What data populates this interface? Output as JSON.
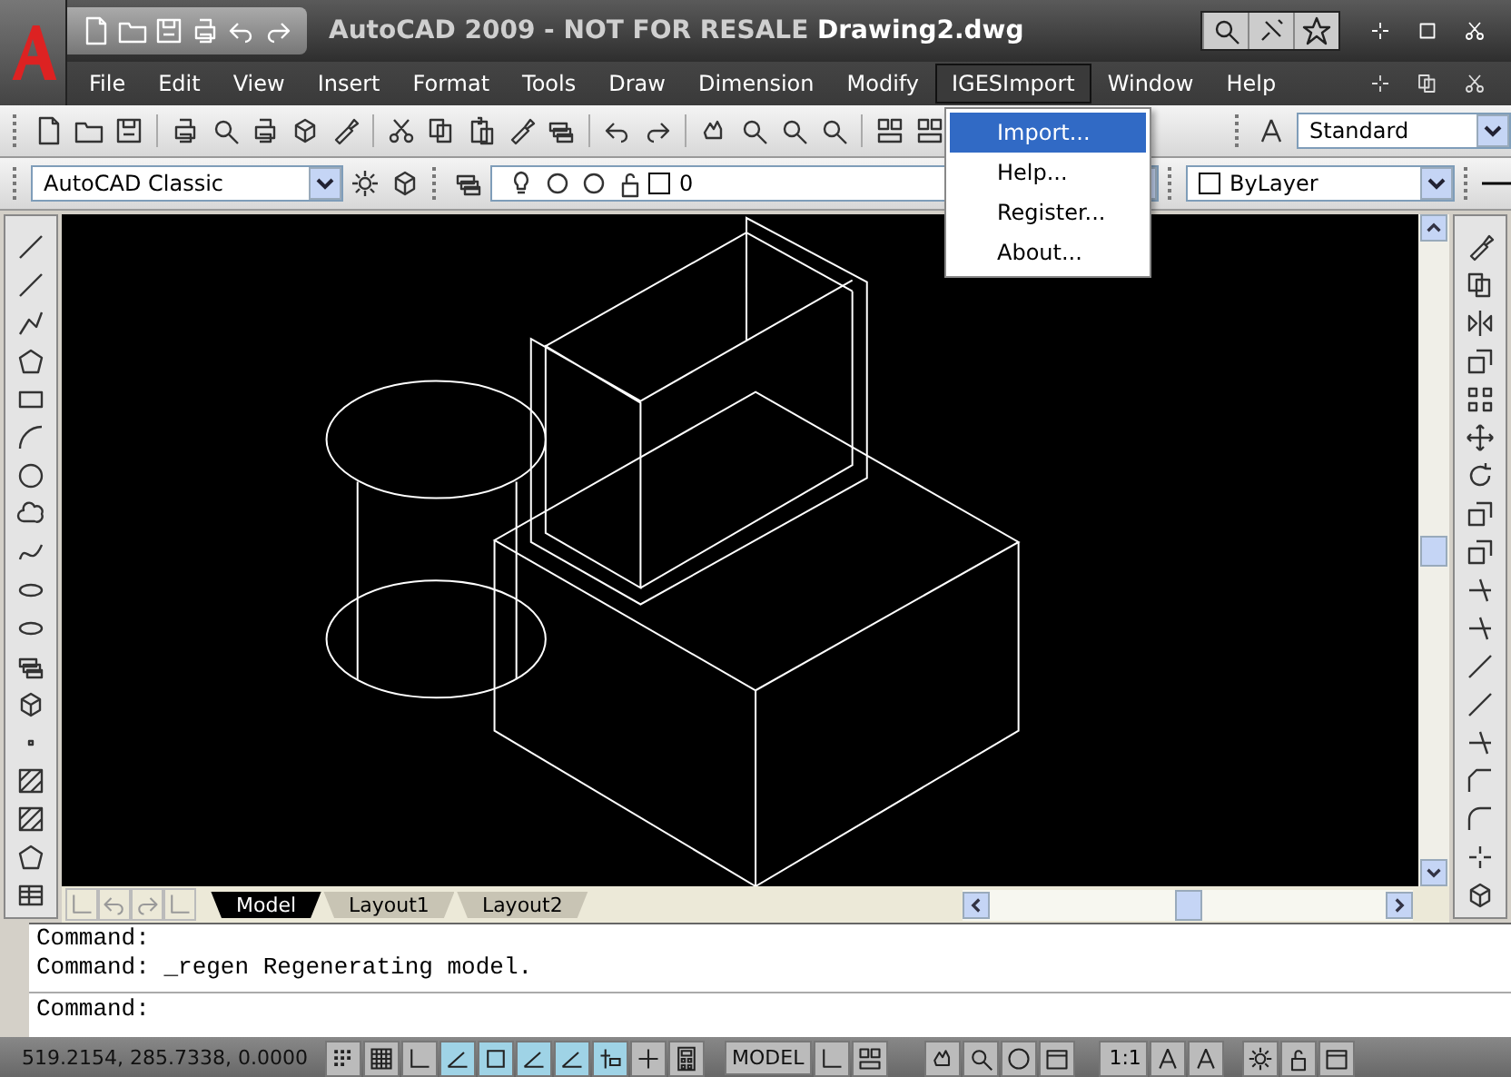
{
  "title_bar": {
    "title": "AutoCAD 2009 - NOT FOR RESALE",
    "document": "Drawing2.dwg"
  },
  "menu_bar": [
    {
      "label": "File",
      "selected": false
    },
    {
      "label": "Edit",
      "selected": false
    },
    {
      "label": "View",
      "selected": false
    },
    {
      "label": "Insert",
      "selected": false
    },
    {
      "label": "Format",
      "selected": false
    },
    {
      "label": "Tools",
      "selected": false
    },
    {
      "label": "Draw",
      "selected": false
    },
    {
      "label": "Dimension",
      "selected": false
    },
    {
      "label": "Modify",
      "selected": false
    },
    {
      "label": "IGESImport",
      "selected": true
    },
    {
      "label": "Window",
      "selected": false
    },
    {
      "label": "Help",
      "selected": false
    }
  ],
  "menu_dropdown": [
    {
      "label": "Import...",
      "selected": true
    },
    {
      "label": "Help...",
      "selected": false
    },
    {
      "label": "Register...",
      "selected": false
    },
    {
      "label": "About...",
      "selected": false
    }
  ],
  "text_style": {
    "value": "Standard"
  },
  "workspace": {
    "value": "AutoCAD Classic"
  },
  "layer": {
    "value": "0"
  },
  "color": {
    "value": "ByLayer"
  },
  "layout_tabs": [
    {
      "label": "Model",
      "selected": true
    },
    {
      "label": "Layout1",
      "selected": false
    },
    {
      "label": "Layout2",
      "selected": false
    }
  ],
  "command_history": [
    "Command:",
    "Command: _regen Regenerating model."
  ],
  "command_prompt": "Command:",
  "status_bar": {
    "coordinates": "519.2154, 285.7338, 0.0000",
    "toggles": [
      {
        "on": false
      },
      {
        "on": false
      },
      {
        "on": false
      },
      {
        "on": true
      },
      {
        "on": true
      },
      {
        "on": true
      },
      {
        "on": true
      },
      {
        "on": true
      },
      {
        "on": false
      },
      {
        "on": false
      }
    ],
    "space": "MODEL",
    "annotation_scale": "1:1"
  }
}
